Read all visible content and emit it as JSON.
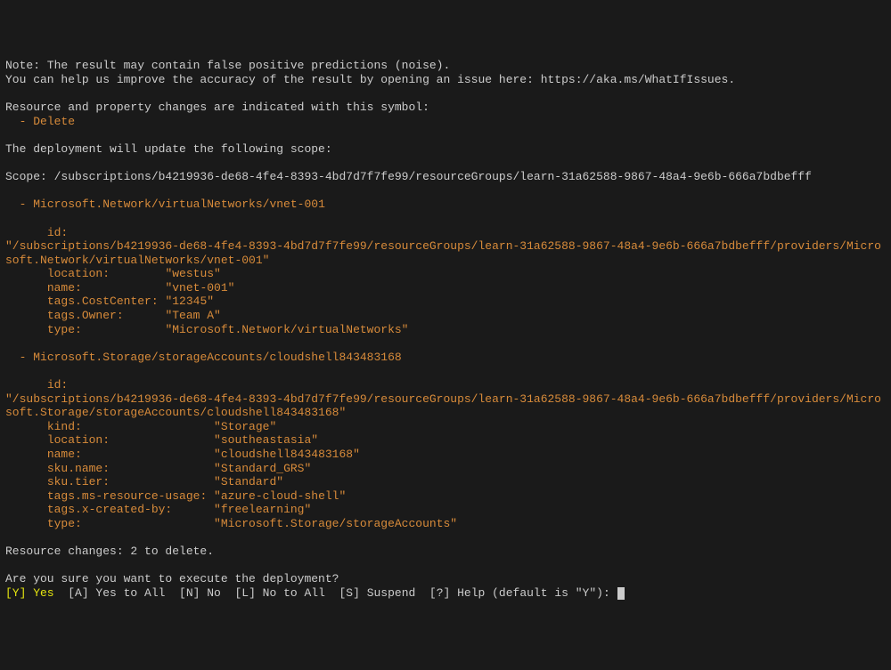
{
  "note_line1": "Note: The result may contain false positive predictions (noise).",
  "note_line2": "You can help us improve the accuracy of the result by opening an issue here: https://aka.ms/WhatIfIssues.",
  "changes_intro": "Resource and property changes are indicated with this symbol:",
  "delete_symbol": "  - Delete",
  "scope_intro": "The deployment will update the following scope:",
  "scope_line": "Scope: /subscriptions/b4219936-de68-4fe4-8393-4bd7d7f7fe99/resourceGroups/learn-31a62588-9867-48a4-9e6b-666a7bdbefff",
  "resource1": {
    "header": "  - Microsoft.Network/virtualNetworks/vnet-001",
    "id_label": "      id:",
    "id_value": "\"/subscriptions/b4219936-de68-4fe4-8393-4bd7d7f7fe99/resourceGroups/learn-31a62588-9867-48a4-9e6b-666a7bdbefff/providers/Microsoft.Network/virtualNetworks/vnet-001\"",
    "location_label": "      location:       ",
    "location_value": " \"westus\"",
    "name_label": "      name:           ",
    "name_value": " \"vnet-001\"",
    "costcenter_label": "      tags.CostCenter:",
    "costcenter_value": " \"12345\"",
    "owner_label": "      tags.Owner:     ",
    "owner_value": " \"Team A\"",
    "type_label": "      type:           ",
    "type_value": " \"Microsoft.Network/virtualNetworks\""
  },
  "resource2": {
    "header": "  - Microsoft.Storage/storageAccounts/cloudshell843483168",
    "id_label": "      id:",
    "id_value": "\"/subscriptions/b4219936-de68-4fe4-8393-4bd7d7f7fe99/resourceGroups/learn-31a62588-9867-48a4-9e6b-666a7bdbefff/providers/Microsoft.Storage/storageAccounts/cloudshell843483168\"",
    "kind_label": "      kind:                  ",
    "kind_value": " \"Storage\"",
    "location_label": "      location:              ",
    "location_value": " \"southeastasia\"",
    "name_label": "      name:                  ",
    "name_value": " \"cloudshell843483168\"",
    "skuname_label": "      sku.name:              ",
    "skuname_value": " \"Standard_GRS\"",
    "skutier_label": "      sku.tier:              ",
    "skutier_value": " \"Standard\"",
    "tagsusage_label": "      tags.ms-resource-usage:",
    "tagsusage_value": " \"azure-cloud-shell\"",
    "tagscreated_label": "      tags.x-created-by:     ",
    "tagscreated_value": " \"freelearning\"",
    "type_label": "      type:                  ",
    "type_value": " \"Microsoft.Storage/storageAccounts\""
  },
  "summary": "Resource changes: 2 to delete.",
  "confirm_question": "Are you sure you want to execute the deployment?",
  "prompt": {
    "y_key": "[Y] Yes",
    "a_key": "  [A] Yes to All",
    "n_key": "  [N] No",
    "l_key": "  [L] No to All",
    "s_key": "  [S] Suspend",
    "help_key": "  [?] Help (default is \"Y\"): "
  }
}
